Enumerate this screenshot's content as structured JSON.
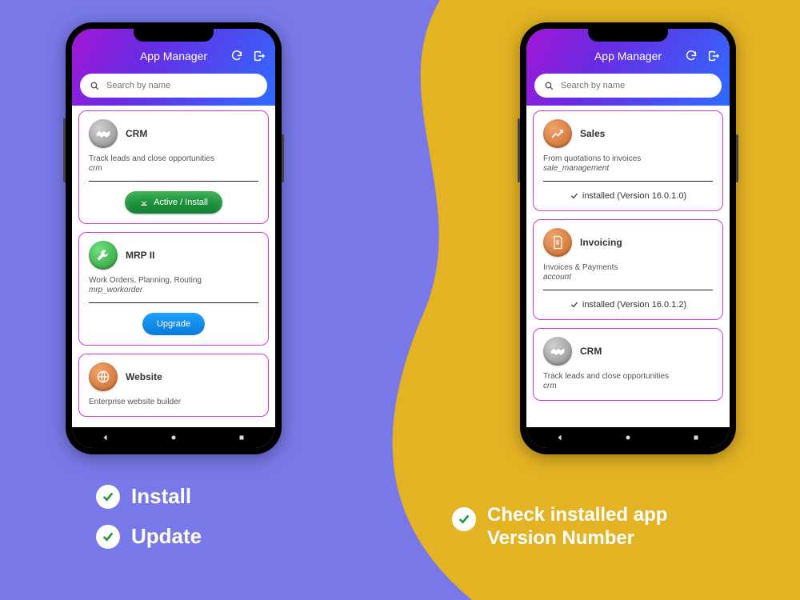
{
  "header": {
    "title": "App Manager"
  },
  "search": {
    "placeholder": "Search by name"
  },
  "colors": {
    "card_border": "#d63ad6",
    "btn_green": "#1f9a3d",
    "btn_blue": "#1591ef"
  },
  "left_phone": {
    "cards": [
      {
        "icon": "handshake",
        "icon_bg": "#9c9c9c",
        "name": "CRM",
        "desc": "Track leads and close opportunities",
        "tech": "crm",
        "action": {
          "type": "install",
          "label": "Active / Install"
        }
      },
      {
        "icon": "wrench",
        "icon_bg": "#3bb24a",
        "name": "MRP II",
        "desc": "Work Orders, Planning, Routing",
        "tech": "mrp_workorder",
        "action": {
          "type": "upgrade",
          "label": "Upgrade"
        }
      },
      {
        "icon": "globe",
        "icon_bg": "#d77b3a",
        "name": "Website",
        "desc": "Enterprise website builder",
        "tech": "",
        "action": null
      }
    ]
  },
  "right_phone": {
    "cards": [
      {
        "icon": "chart",
        "icon_bg": "#d46a2e",
        "name": "Sales",
        "desc": "From quotations to invoices",
        "tech": "sale_management",
        "status": "installed (Version 16.0.1.0)"
      },
      {
        "icon": "invoice",
        "icon_bg": "#d46a2e",
        "name": "Invoicing",
        "desc": "Invoices & Payments",
        "tech": "account",
        "status": "installed (Version 16.0.1.2)"
      },
      {
        "icon": "handshake",
        "icon_bg": "#9c9c9c",
        "name": "CRM",
        "desc": "Track leads and close opportunities",
        "tech": "crm",
        "status": ""
      }
    ]
  },
  "captions": {
    "install": "Install",
    "update": "Update",
    "right_line1": "Check installed app",
    "right_line2": "Version Number"
  }
}
